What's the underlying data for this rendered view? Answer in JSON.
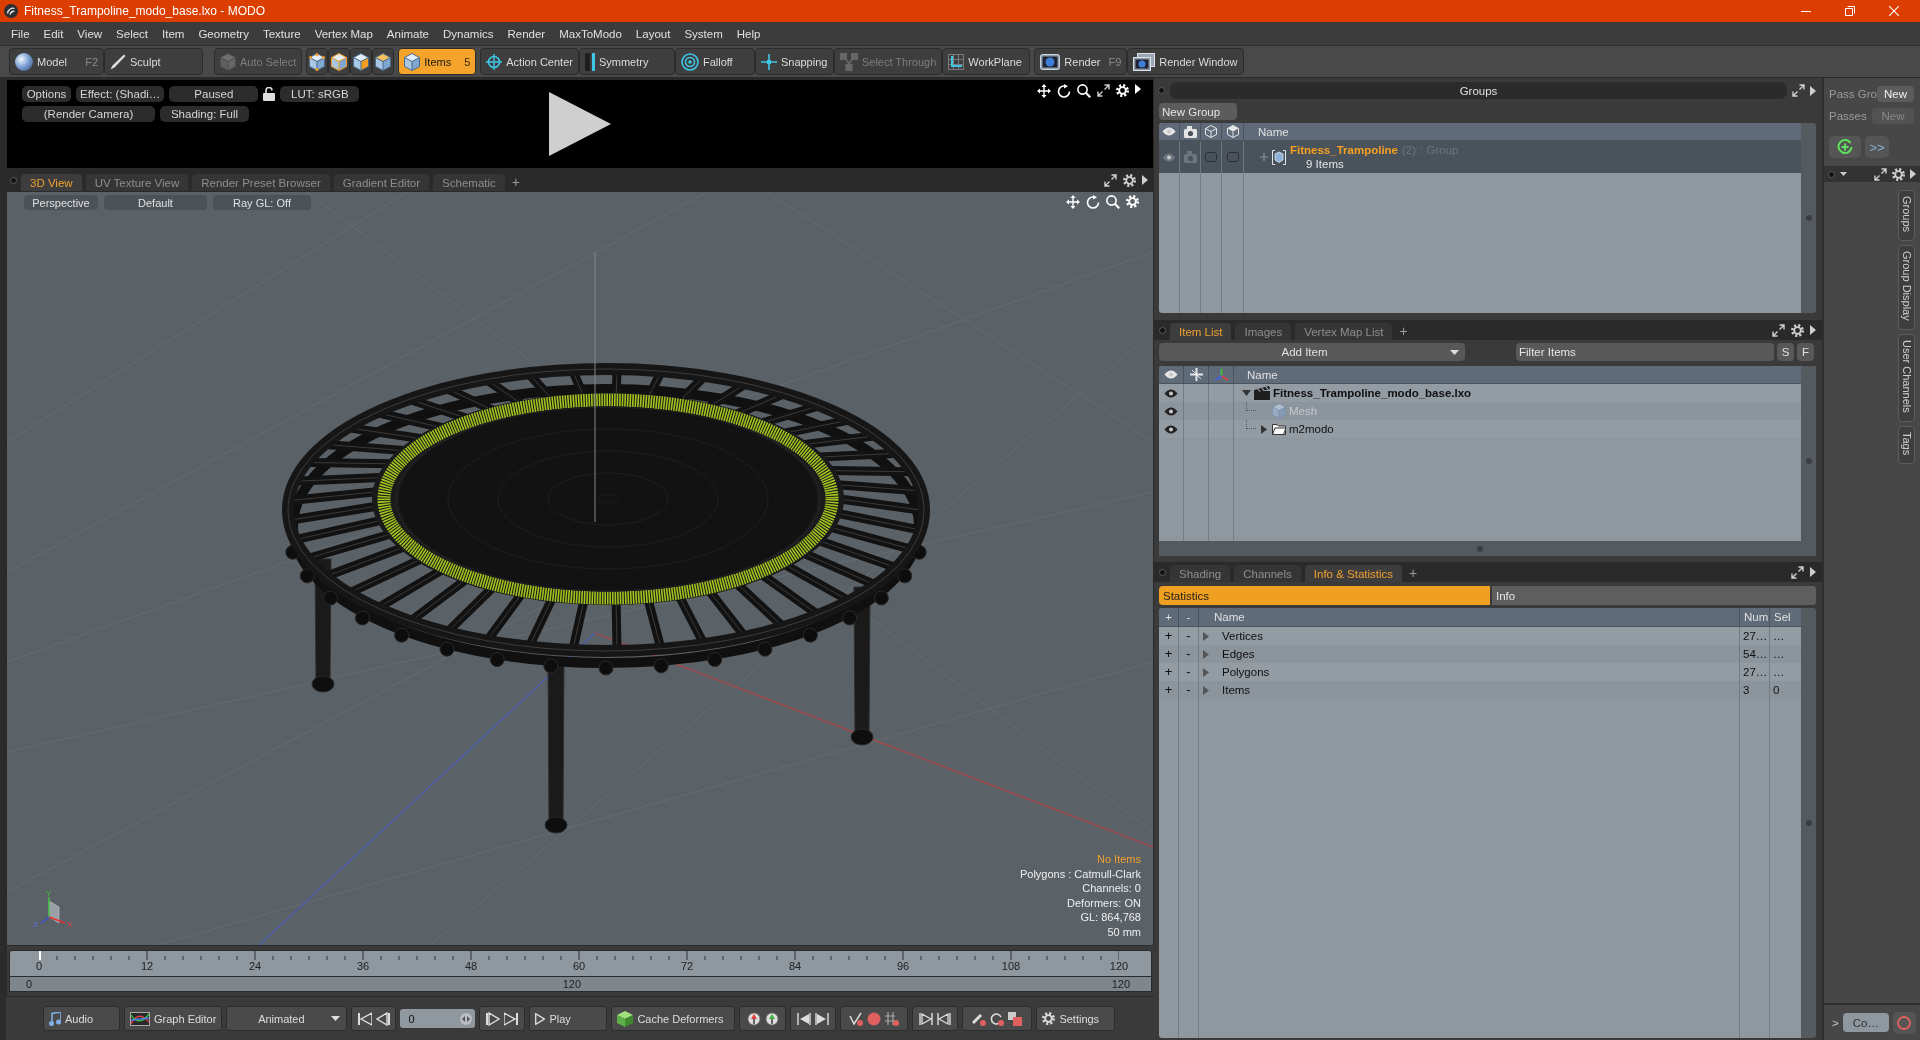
{
  "window": {
    "title": "Fitness_Trampoline_modo_base.lxo - MODO"
  },
  "menu": [
    "File",
    "Edit",
    "View",
    "Select",
    "Item",
    "Geometry",
    "Texture",
    "Vertex Map",
    "Animate",
    "Dynamics",
    "Render",
    "MaxToModo",
    "Layout",
    "System",
    "Help"
  ],
  "toolbar": [
    {
      "kind": "button",
      "label": "Model",
      "shortcut": "F2",
      "selected": false,
      "disabled": false
    },
    {
      "kind": "button",
      "label": "Sculpt",
      "selected": false,
      "disabled": false
    },
    {
      "kind": "button",
      "label": "Auto Select",
      "selected": false,
      "disabled": true
    },
    {
      "kind": "icon",
      "selected": false,
      "disabled": false
    },
    {
      "kind": "icon",
      "selected": false,
      "disabled": false
    },
    {
      "kind": "icon",
      "selected": false,
      "disabled": false
    },
    {
      "kind": "icon",
      "selected": false,
      "disabled": false
    },
    {
      "kind": "button",
      "label": "Items",
      "shortcut": "5",
      "selected": true,
      "disabled": false
    },
    {
      "kind": "button",
      "label": "Action Center",
      "selected": false,
      "disabled": false
    },
    {
      "kind": "button",
      "label": "Symmetry",
      "selected": false,
      "disabled": false
    },
    {
      "kind": "button",
      "label": "Falloff",
      "selected": false,
      "disabled": false
    },
    {
      "kind": "button",
      "label": "Snapping",
      "selected": false,
      "disabled": false
    },
    {
      "kind": "button",
      "label": "Select Through",
      "selected": false,
      "disabled": true
    },
    {
      "kind": "button",
      "label": "WorkPlane",
      "selected": false,
      "disabled": false
    },
    {
      "kind": "button",
      "label": "Render",
      "shortcut": "F9",
      "selected": false,
      "disabled": false
    },
    {
      "kind": "button",
      "label": "Render Window",
      "selected": false,
      "disabled": false
    }
  ],
  "preview": {
    "top_controls": [
      {
        "kind": "button",
        "label": "Options"
      },
      {
        "kind": "button",
        "label": "Effect: (Shadi…"
      },
      {
        "kind": "button",
        "label": "Paused"
      },
      {
        "kind": "lock"
      },
      {
        "kind": "button",
        "label": "LUT: sRGB"
      }
    ],
    "bottom_controls": [
      {
        "kind": "button",
        "label": "(Render Camera)"
      },
      {
        "kind": "button",
        "label": "Shading: Full"
      }
    ]
  },
  "viewport_tabs": {
    "tabs": [
      {
        "label": "3D View",
        "selected": true
      },
      {
        "label": "UV Texture View",
        "selected": false
      },
      {
        "label": "Render Preset Browser",
        "selected": false
      },
      {
        "label": "Gradient Editor",
        "selected": false
      },
      {
        "label": "Schematic",
        "selected": false
      }
    ],
    "add": "+"
  },
  "viewport": {
    "toolbar": [
      "Perspective",
      "Default",
      "Ray GL: Off"
    ],
    "status": "No Items",
    "info": [
      "Polygons : Catmull-Clark",
      "Channels: 0",
      "Deformers: ON",
      "GL: 864,768",
      "50 mm"
    ],
    "axis_labels": {
      "y": "Y",
      "z": "Z",
      "x": "X"
    }
  },
  "timeline": {
    "ticks": [
      "0",
      "12",
      "24",
      "36",
      "48",
      "60",
      "72",
      "84",
      "96",
      "108",
      "120"
    ],
    "level": 0,
    "range": [
      "0",
      "120",
      "120"
    ]
  },
  "transport": {
    "audio": "Audio",
    "graph_editor": "Graph Editor",
    "mode": "Animated",
    "frame": "0",
    "play": "Play",
    "cache": "Cache Deformers",
    "settings": "Settings"
  },
  "groups": {
    "title": "Groups",
    "new_group": "New Group",
    "name_column": "Name",
    "rows": [
      {
        "name": "Fitness_Trampoline",
        "count": "(2)",
        "type": ": Group",
        "detail": "9 Items",
        "selected": true,
        "visible": true,
        "toggles": [
          {
            "checked": false
          },
          {
            "checked": false
          }
        ]
      }
    ]
  },
  "item_list": {
    "tabs": [
      {
        "label": "Item List",
        "selected": true
      },
      {
        "label": "Images",
        "selected": false
      },
      {
        "label": "Vertex Map List",
        "selected": false
      }
    ],
    "add": "+",
    "add_item": "Add Item",
    "filter": {
      "placeholder": "Filter Items"
    },
    "filter_buttons": [
      "S",
      "F"
    ],
    "name_column": "Name",
    "tree": [
      {
        "kind": "scene",
        "label": "Fitness_Trampoline_modo_base.lxo",
        "visible": true,
        "disabled": false,
        "expanded": true,
        "children": [
          {
            "kind": "mesh",
            "label": "Mesh",
            "visible": true,
            "disabled": true
          },
          {
            "kind": "folder",
            "label": "m2modo",
            "visible": true,
            "disabled": false,
            "expanded": false
          }
        ]
      }
    ]
  },
  "stats": {
    "tabs": [
      {
        "label": "Shading",
        "selected": false
      },
      {
        "label": "Channels",
        "selected": false
      },
      {
        "label": "Info & Statistics",
        "selected": true
      }
    ],
    "add": "+",
    "subtabs": [
      {
        "label": "Statistics",
        "selected": true
      },
      {
        "label": "Info",
        "selected": false
      }
    ],
    "columns": [
      "+",
      "-",
      "Name",
      "Num",
      "Sel"
    ],
    "rows": [
      {
        "add": "+",
        "remove": "-",
        "name": "Vertices",
        "num": "27…",
        "sel": "…",
        "expanded": false
      },
      {
        "add": "+",
        "remove": "-",
        "name": "Edges",
        "num": "54…",
        "sel": "…",
        "expanded": false
      },
      {
        "add": "+",
        "remove": "-",
        "name": "Polygons",
        "num": "27…",
        "sel": "…",
        "expanded": false
      },
      {
        "add": "+",
        "remove": "-",
        "name": "Items",
        "num": "3",
        "sel": "0",
        "expanded": false
      }
    ]
  },
  "sidebar": {
    "pass_groups": {
      "label": "Pass Gro",
      "button": "New",
      "disabled": false
    },
    "passes": {
      "label": "Passes",
      "button": "New",
      "disabled": true
    },
    "more": ">>",
    "vertical_tabs": [
      "Groups",
      "Group Display",
      "User Channels",
      "Tags"
    ],
    "command": {
      "prompt": ">",
      "button": "Co…"
    }
  }
}
